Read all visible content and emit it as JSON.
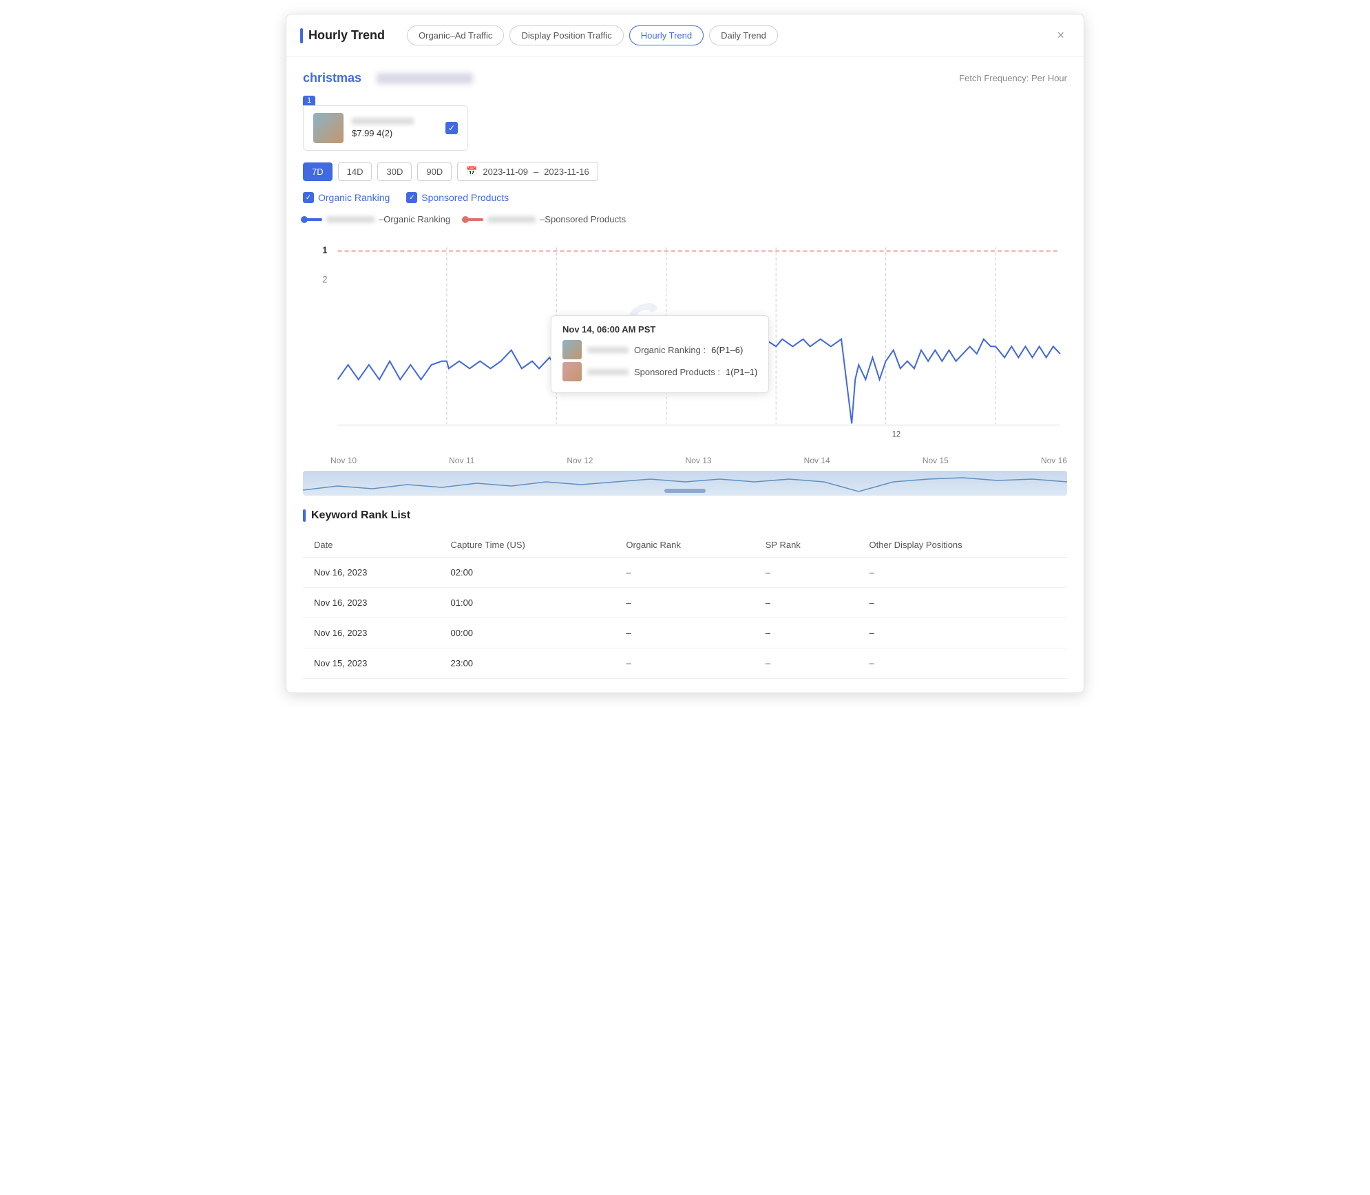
{
  "modal": {
    "title": "Hourly Trend",
    "close_label": "×",
    "fetch_frequency": "Fetch Frequency: Per Hour"
  },
  "nav_tabs": [
    {
      "id": "organic-ad",
      "label": "Organic–Ad Traffic",
      "active": false
    },
    {
      "id": "display-position",
      "label": "Display Position Traffic",
      "active": false
    },
    {
      "id": "hourly-trend",
      "label": "Hourly Trend",
      "active": true
    },
    {
      "id": "daily-trend",
      "label": "Daily Trend",
      "active": false
    }
  ],
  "keyword": {
    "name": "christmas"
  },
  "product_card": {
    "rank": "1",
    "price": "$7.99 4(2)"
  },
  "date_periods": [
    {
      "label": "7D",
      "active": true
    },
    {
      "label": "14D",
      "active": false
    },
    {
      "label": "30D",
      "active": false
    },
    {
      "label": "90D",
      "active": false
    }
  ],
  "date_range": {
    "start": "2023-11-09",
    "separator": "–",
    "end": "2023-11-16"
  },
  "filters": [
    {
      "label": "Organic Ranking",
      "checked": true
    },
    {
      "label": "Sponsored Products",
      "checked": true
    }
  ],
  "legend": {
    "organic_label": "–Organic Ranking",
    "sponsored_label": "–Sponsored Products"
  },
  "chart": {
    "y_label_1": "1",
    "y_label_2": "2",
    "y_label_12": "12",
    "tooltip": {
      "time": "Nov 14, 06:00 AM PST",
      "organic_label": "Organic Ranking :",
      "organic_value": "6(P1–6)",
      "sponsored_label": "Sponsored Products :",
      "sponsored_value": "1(P1–1)"
    }
  },
  "xaxis": {
    "labels": [
      "Nov 10",
      "Nov 11",
      "Nov 12",
      "Nov 13",
      "Nov 14",
      "Nov 15",
      "Nov 16"
    ]
  },
  "rank_list": {
    "title": "Keyword Rank List",
    "columns": [
      "Date",
      "Capture Time (US)",
      "Organic Rank",
      "SP Rank",
      "Other Display Positions"
    ],
    "rows": [
      {
        "date": "Nov 16, 2023",
        "time": "02:00",
        "organic": "–",
        "sp": "–",
        "other": "–"
      },
      {
        "date": "Nov 16, 2023",
        "time": "01:00",
        "organic": "–",
        "sp": "–",
        "other": "–"
      },
      {
        "date": "Nov 16, 2023",
        "time": "00:00",
        "organic": "–",
        "sp": "–",
        "other": "–"
      },
      {
        "date": "Nov 15, 2023",
        "time": "23:00",
        "organic": "–",
        "sp": "–",
        "other": "–"
      }
    ]
  }
}
